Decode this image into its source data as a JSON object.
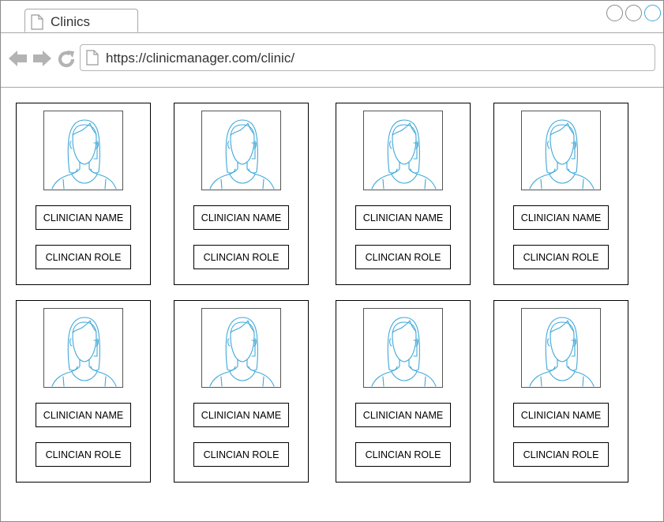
{
  "browser": {
    "tab_title": "Clinics",
    "url": "https://clinicmanager.com/clinic/",
    "icons": {
      "tab": "document-icon",
      "back": "back-arrow-icon",
      "forward": "forward-arrow-icon",
      "reload": "reload-icon",
      "url": "document-icon"
    },
    "accent_color": "#3fa8d8"
  },
  "clinicians": [
    {
      "name": "CLINICIAN NAME",
      "role": "CLINCIAN ROLE",
      "avatar_icon": "female-avatar-icon"
    },
    {
      "name": "CLINICIAN NAME",
      "role": "CLINCIAN ROLE",
      "avatar_icon": "female-avatar-icon"
    },
    {
      "name": "CLINICIAN NAME",
      "role": "CLINCIAN ROLE",
      "avatar_icon": "female-avatar-icon"
    },
    {
      "name": "CLINICIAN NAME",
      "role": "CLINCIAN ROLE",
      "avatar_icon": "female-avatar-icon"
    },
    {
      "name": "CLINICIAN NAME",
      "role": "CLINCIAN ROLE",
      "avatar_icon": "female-avatar-icon"
    },
    {
      "name": "CLINICIAN NAME",
      "role": "CLINCIAN ROLE",
      "avatar_icon": "female-avatar-icon"
    },
    {
      "name": "CLINICIAN NAME",
      "role": "CLINCIAN ROLE",
      "avatar_icon": "female-avatar-icon"
    },
    {
      "name": "CLINICIAN NAME",
      "role": "CLINCIAN ROLE",
      "avatar_icon": "female-avatar-icon"
    }
  ]
}
